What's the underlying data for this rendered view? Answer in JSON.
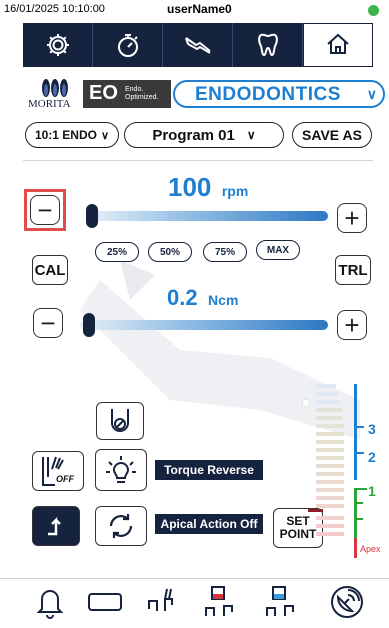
{
  "status": {
    "datetime": "16/01/2025 10:10:00",
    "user": "userName0",
    "online_color": "#3bb54a"
  },
  "top_nav": {
    "items": [
      {
        "icon": "gear-icon"
      },
      {
        "icon": "stopwatch-icon"
      },
      {
        "icon": "tools-icon"
      },
      {
        "icon": "tooth-icon"
      },
      {
        "icon": "home-icon"
      }
    ]
  },
  "brand": {
    "morita": "MORITA",
    "eo_logo": "EO",
    "eo_small": "Endo.\nOptimized.",
    "mode": "ENDODONTICS"
  },
  "program": {
    "ratio": "10:1 ENDO",
    "program_name": "Program 01",
    "save_as": "SAVE AS"
  },
  "speed": {
    "value": "100",
    "unit": "rpm",
    "level": 0.0,
    "presets": [
      "25%",
      "50%",
      "75%",
      "MAX"
    ]
  },
  "torque": {
    "value": "0.2",
    "unit": "Ncm",
    "level": 0.0
  },
  "side_buttons": {
    "cal": "CAL",
    "trl": "TRL"
  },
  "functions": {
    "light_off_label": "OFF",
    "torque_reverse": "Torque Reverse",
    "apical_action": "Apical Action Off",
    "set_point_line1": "SET",
    "set_point_line2": "POINT"
  },
  "apex_meter": {
    "marks": [
      "3",
      "2",
      "1"
    ],
    "apex_label": "Apex",
    "accent": "#1e7fd0",
    "zone_colors": {
      "green": "#2aa53a",
      "red": "#d9353f"
    }
  },
  "colors": {
    "navy": "#16233f",
    "accent": "#1e7fd0",
    "highlight": "#e24b4b"
  },
  "bottom_nav": {
    "items": [
      {
        "icon": "bell-icon"
      },
      {
        "icon": "rectangle-icon"
      },
      {
        "icon": "file-handpiece-icon"
      },
      {
        "icon": "file-red-handpiece-icon"
      },
      {
        "icon": "file-blue-handpiece-icon"
      },
      {
        "icon": "satellite-dish-icon"
      }
    ]
  }
}
